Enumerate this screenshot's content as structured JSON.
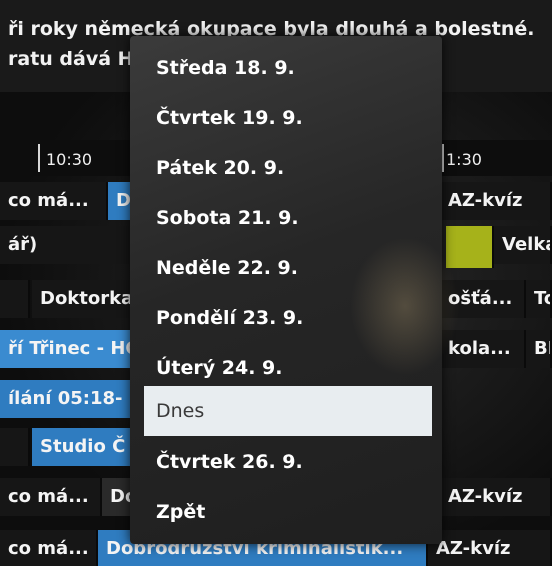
{
  "description": {
    "line1": "ři roky německá okupace byla dlouhá a bolestné.",
    "line2": "ratu dává Hi                                            rancouzský"
  },
  "timeline": {
    "left_time": "10:30",
    "right_time": "1:30"
  },
  "rows": [
    {
      "left": "co má...",
      "left2": "Do",
      "right": "AZ-kvíz"
    },
    {
      "left": "ář)",
      "right": "Velká"
    },
    {
      "left": "",
      "left2": "Doktorka",
      "right": "ošťá...",
      "right2": "To"
    },
    {
      "left": "ří Třinec - HC",
      "right": "kola...",
      "right2": "BI"
    },
    {
      "left": "ílání 05:18-"
    },
    {
      "left2": "Studio Č"
    },
    {
      "left": "co má...",
      "left2": "Do",
      "right": "AZ-kvíz"
    },
    {
      "left": "co má...",
      "left2": "Dobrodružství kriminalistik...",
      "right": "AZ-kvíz"
    }
  ],
  "menu": {
    "items": [
      "Středa 18. 9.",
      "Čtvrtek 19. 9.",
      "Pátek 20. 9.",
      "Sobota 21. 9.",
      "Neděle 22. 9.",
      "Pondělí 23. 9.",
      "Úterý 24. 9.",
      "Dnes",
      "Čtvrtek 26. 9.",
      "Zpět"
    ],
    "selected_index": 7
  },
  "colors": {
    "blue": "#2f7cc0",
    "green": "#a6b21a",
    "menu_selected": "#e8edf0"
  }
}
